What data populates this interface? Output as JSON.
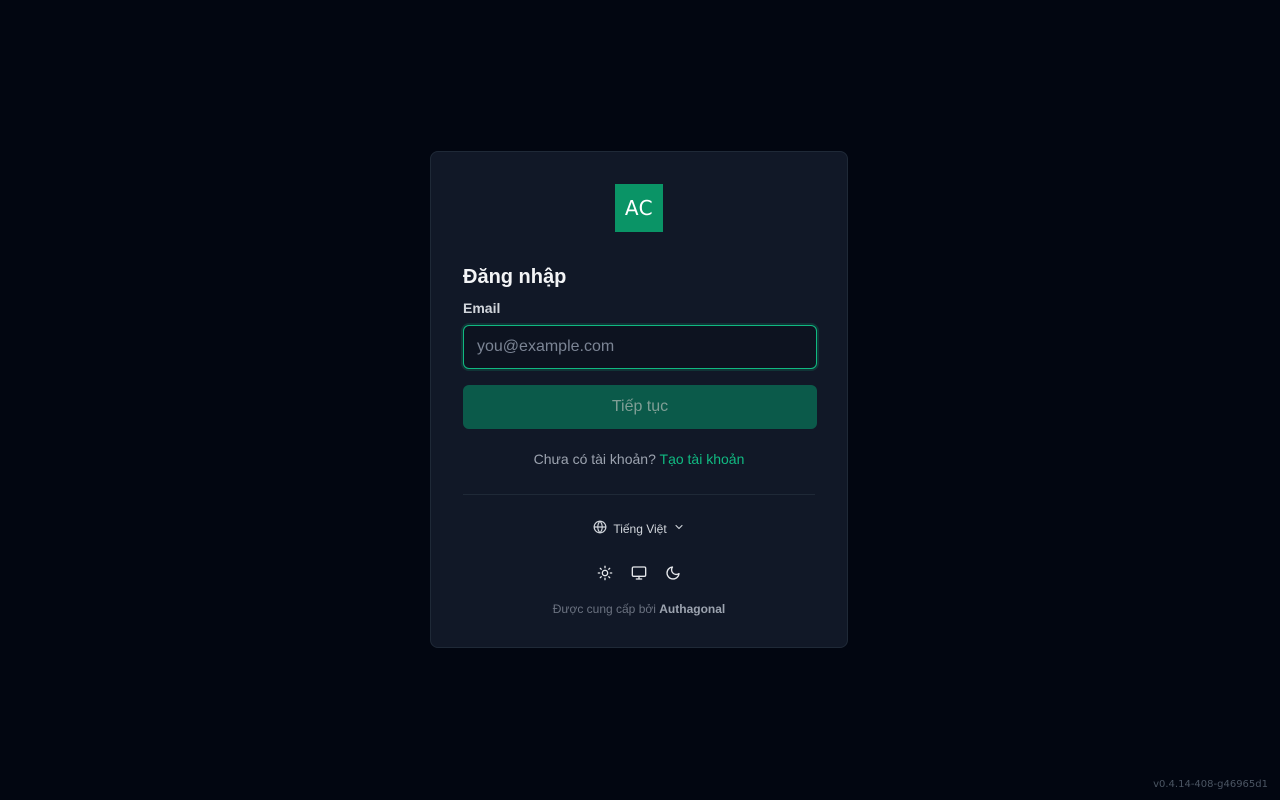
{
  "brand": {
    "logo_text": "AC",
    "logo_color": "#0a9466",
    "accent_color": "#10b981"
  },
  "login": {
    "title": "Đăng nhập",
    "email_label": "Email",
    "email_placeholder": "you@example.com",
    "email_value": "",
    "continue_label": "Tiếp tục",
    "no_account_text": "Chưa có tài khoản?",
    "create_account_link": "Tạo tài khoản"
  },
  "language": {
    "icon": "globe-icon",
    "selected": "Tiếng Việt",
    "chevron_icon": "chevron-down-icon"
  },
  "theme": {
    "options": [
      {
        "name": "light",
        "icon": "sun-icon"
      },
      {
        "name": "system",
        "icon": "monitor-icon"
      },
      {
        "name": "dark",
        "icon": "moon-icon"
      }
    ]
  },
  "footer": {
    "powered_by": "Được cung cấp bởi",
    "provider": "Authagonal",
    "version": "v0.4.14-408-g46965d1"
  }
}
